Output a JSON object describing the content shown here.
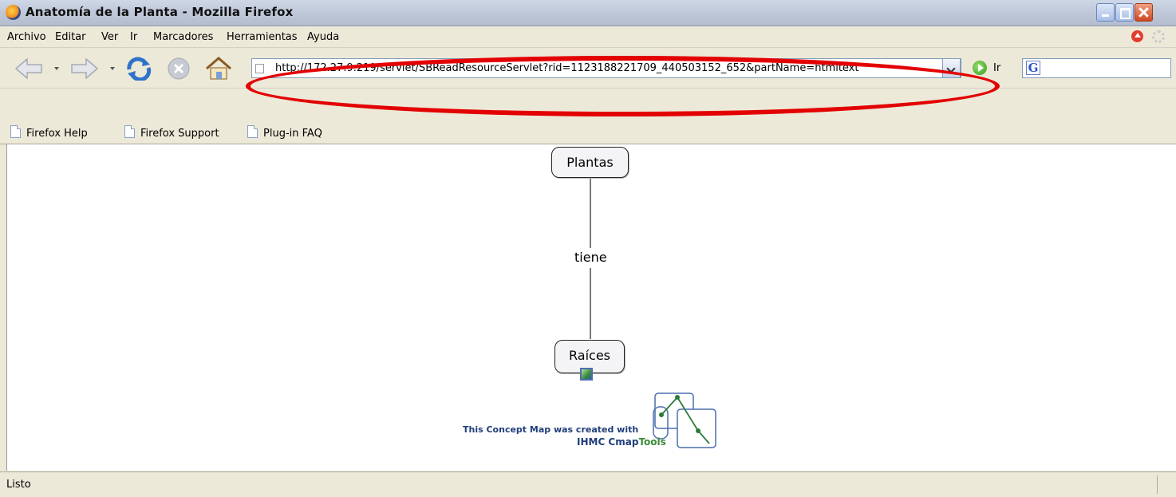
{
  "window": {
    "title": "Anatomía de la Planta - Mozilla Firefox",
    "app_icon": "firefox-icon",
    "controls": [
      "minimize-icon",
      "maximize-icon",
      "close-icon"
    ]
  },
  "menubar": {
    "items": [
      {
        "label": "Archivo"
      },
      {
        "label": "Editar"
      },
      {
        "label": "Ver"
      },
      {
        "label": "Ir"
      },
      {
        "label": "Marcadores"
      },
      {
        "label": "Herramientas"
      },
      {
        "label": "Ayuda"
      }
    ]
  },
  "navbar": {
    "buttons": [
      "back-arrow-icon",
      "forward-arrow-icon",
      "reload-icon",
      "stop-icon",
      "home-icon"
    ],
    "url": "http://172.27.9.219/servlet/SBReadResourceServlet?rid=1123188221709_440503152_652&partName=htmltext",
    "go_label": "Ir",
    "search_engine_icon": "google-icon",
    "search_value": "",
    "highlight_color": "#e30000"
  },
  "bookmarks": {
    "items": [
      {
        "label": "Firefox Help"
      },
      {
        "label": "Firefox Support"
      },
      {
        "label": "Plug-in FAQ"
      }
    ]
  },
  "concept_map": {
    "nodes": [
      {
        "label": "Plantas"
      },
      {
        "label": "Raíces"
      }
    ],
    "link_label": "tiene",
    "resource_icon": "image-resource-icon",
    "credit_line1": "This Concept Map was created with",
    "credit_brand_ihmc": "IHMC Cmap",
    "credit_brand_tools": "Tools"
  },
  "statusbar": {
    "text": "Listo"
  }
}
